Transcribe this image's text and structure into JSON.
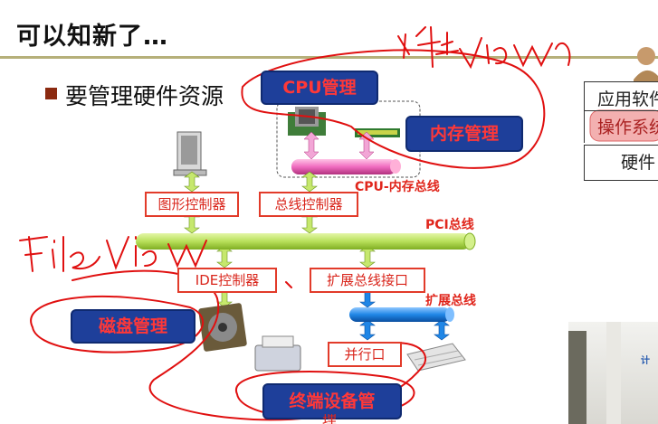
{
  "slide": {
    "title": "可以知新了…",
    "bullet": "要管理硬件资源"
  },
  "diagram": {
    "pills": {
      "cpu": "CPU管理",
      "memory": "内存管理",
      "disk": "磁盘管理",
      "terminal": "终端设备管",
      "terminal_tail": "理"
    },
    "boxes": {
      "graphics": "图形控制器",
      "bus": "总线控制器",
      "ide": "IDE控制器",
      "expansion_interface": "扩展总线接口",
      "parallel": "并行口"
    },
    "labels": {
      "cpu_memory_bus": "CPU-内存总线",
      "pci_bus": "PCI总线",
      "expansion_bus": "扩展总线"
    }
  },
  "annotations": {
    "file_view": "File View",
    "process_view": "进程 View"
  },
  "os_table": {
    "rows": [
      "应用软件",
      "操作系统",
      "硬件"
    ]
  },
  "colors": {
    "accent_red": "#e0261c",
    "pill_blue": "#1e3f9a",
    "bus_green": "#b8e05a",
    "ink": "#e01010"
  }
}
